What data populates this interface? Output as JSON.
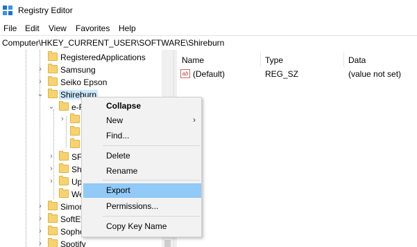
{
  "window": {
    "title": "Registry Editor",
    "app_icon": "registry-editor-icon"
  },
  "menu": [
    "File",
    "Edit",
    "View",
    "Favorites",
    "Help"
  ],
  "address": "Computer\\HKEY_CURRENT_USER\\SOFTWARE\\Shireburn",
  "tree": {
    "items": [
      {
        "label": "RegisteredApplications"
      },
      {
        "label": "Samsung"
      },
      {
        "label": "Seiko Epson"
      },
      {
        "label": "Shireburn"
      },
      {
        "label": "e-F"
      },
      {
        "label": ""
      },
      {
        "label": ""
      },
      {
        "label": ""
      },
      {
        "label": "SFI"
      },
      {
        "label": "Shi"
      },
      {
        "label": "Up"
      },
      {
        "label": "We"
      },
      {
        "label": "Simon"
      },
      {
        "label": "SoftEt"
      },
      {
        "label": "Sopho"
      },
      {
        "label": "Spotify"
      }
    ]
  },
  "list": {
    "columns": [
      "Name",
      "Type",
      "Data"
    ],
    "rows": [
      {
        "icon": "string-value-icon",
        "icon_text": "ab",
        "name": "(Default)",
        "type": "REG_SZ",
        "data": "(value not set)"
      }
    ]
  },
  "context_menu": {
    "items": [
      "Collapse",
      "New",
      "Find...",
      "Delete",
      "Rename",
      "Export",
      "Permissions...",
      "Copy Key Name"
    ],
    "highlighted": "Export"
  },
  "colors": {
    "selection": "#cce8ff",
    "menu_highlight": "#91c9f7",
    "folder": "#f7d26e"
  }
}
